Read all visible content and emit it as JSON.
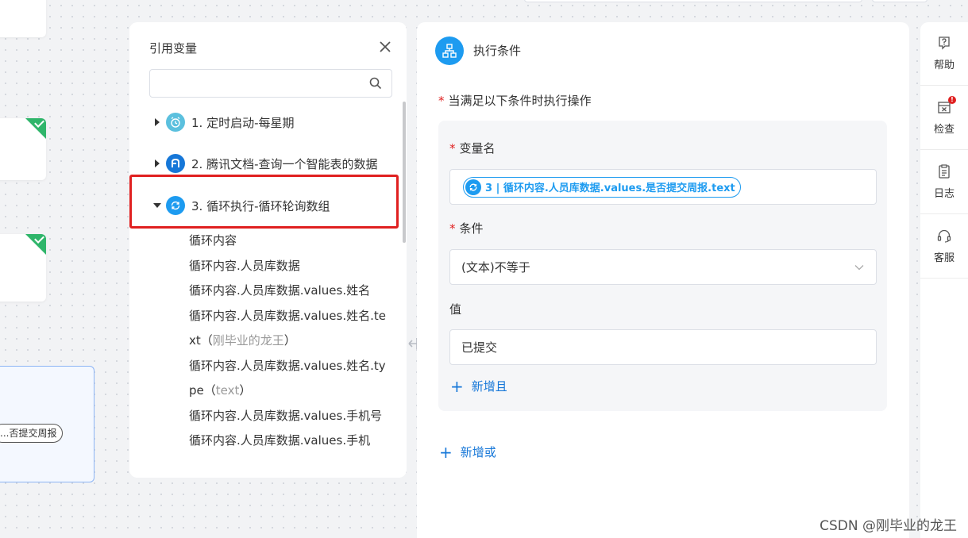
{
  "ref_panel": {
    "title": "引用变量",
    "search_placeholder": "",
    "nodes": [
      {
        "label": "1. 定时启动-每星期",
        "icon": "alarm-clock-icon",
        "color": "#5bc0de",
        "expanded": false
      },
      {
        "label": "2. 腾讯文档-查询一个智能表的数据",
        "icon": "tencent-docs-icon",
        "color": "#1677d8",
        "expanded": false
      },
      {
        "label": "3. 循环执行-循环轮询数组",
        "icon": "loop-icon",
        "color": "#1d9bf0",
        "expanded": true
      }
    ],
    "children": [
      {
        "text": "循环内容"
      },
      {
        "text": "循环内容.人员库数据"
      },
      {
        "text": "循环内容.人员库数据.values.姓名"
      },
      {
        "text": "循环内容.人员库数据.values.姓名.te"
      },
      {
        "text": "xt（",
        "hint": "刚毕业的龙王",
        "tail": "）"
      },
      {
        "text": "循环内容.人员库数据.values.姓名.ty"
      },
      {
        "text": "pe（",
        "hint": "text",
        "tail": "）"
      },
      {
        "text": "循环内容.人员库数据.values.手机号"
      },
      {
        "text": "循环内容.人员库数据.values.手机"
      }
    ]
  },
  "canvas": {
    "loop_card_pill": "否提交周报..."
  },
  "condition_panel": {
    "title": "执行条件",
    "rule_label": "当满足以下条件时执行操作",
    "variable_label": "变量名",
    "variable_tag": "3 | 循环内容.人员库数据.values.是否提交周报.text",
    "condition_label": "条件",
    "condition_value": "(文本)不等于",
    "value_label": "值",
    "value_input": "已提交",
    "add_and": "新增且",
    "add_or": "新增或"
  },
  "rail": {
    "items": [
      {
        "label": "帮助",
        "icon": "help-icon"
      },
      {
        "label": "检查",
        "icon": "check-icon",
        "badge": "!"
      },
      {
        "label": "日志",
        "icon": "log-icon"
      },
      {
        "label": "客服",
        "icon": "headset-icon"
      }
    ]
  },
  "watermark": "CSDN @刚毕业的龙王",
  "colors": {
    "accent": "#1d9bf0",
    "highlight_box": "#e02020",
    "success": "#2fb56a"
  }
}
